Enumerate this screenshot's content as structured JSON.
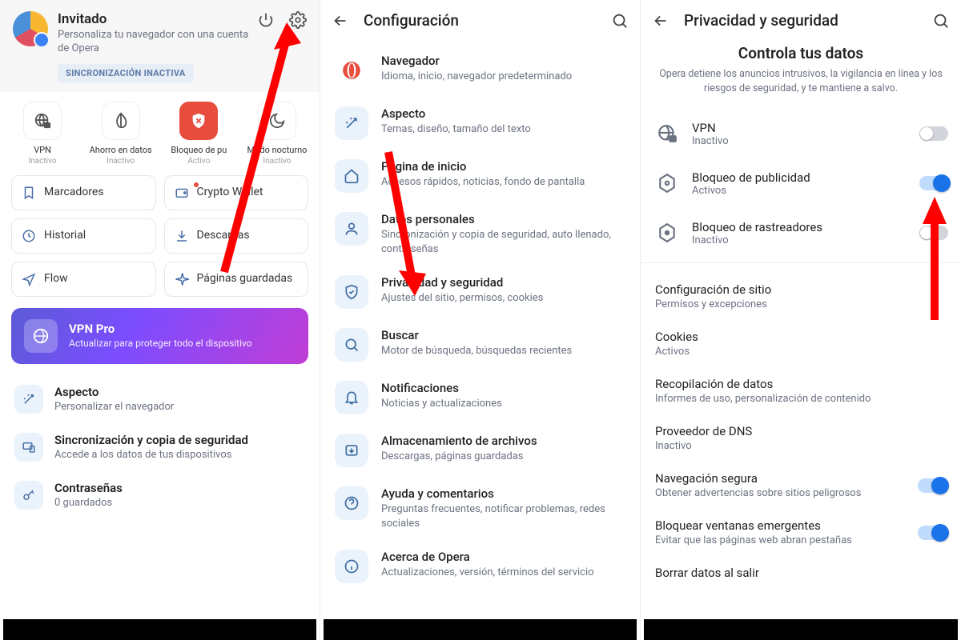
{
  "panel1": {
    "user_title": "Invitado",
    "user_sub": "Personaliza tu navegador con una cuenta de Opera",
    "sync_badge": "SINCRONIZACIÓN INACTIVA",
    "quick": [
      {
        "label": "VPN",
        "status": "Inactivo"
      },
      {
        "label": "Ahorro en datos",
        "status": "Inactivo"
      },
      {
        "label": "Bloqueo de pu",
        "status": "Activo"
      },
      {
        "label": "Modo nocturno",
        "status": "Inactivo"
      }
    ],
    "tiles": [
      {
        "label": "Marcadores"
      },
      {
        "label": "Crypto Wallet"
      },
      {
        "label": "Historial"
      },
      {
        "label": "Descargas"
      },
      {
        "label": "Flow"
      },
      {
        "label": "Páginas guardadas"
      }
    ],
    "vpnpro_title": "VPN Pro",
    "vpnpro_sub": "Actualizar para proteger todo el dispositivo",
    "opts": [
      {
        "title": "Aspecto",
        "sub": "Personalizar el navegador"
      },
      {
        "title": "Sincronización y copia de seguridad",
        "sub": "Accede a los datos de tus dispositivos"
      },
      {
        "title": "Contraseñas",
        "sub": "0 guardados"
      }
    ]
  },
  "panel2": {
    "title": "Configuración",
    "rows": [
      {
        "title": "Navegador",
        "sub": "Idioma, inicio, navegador predeterminado"
      },
      {
        "title": "Aspecto",
        "sub": "Temas, diseño, tamaño del texto"
      },
      {
        "title": "Página de inicio",
        "sub": "Accesos rápidos, noticias, fondo de pantalla"
      },
      {
        "title": "Datos personales",
        "sub": "Sincronización y copia de seguridad, auto llenado, contraseñas"
      },
      {
        "title": "Privacidad y seguridad",
        "sub": "Ajustes del sitio, permisos, cookies"
      },
      {
        "title": "Buscar",
        "sub": "Motor de búsqueda, búsquedas recientes"
      },
      {
        "title": "Notificaciones",
        "sub": "Noticias y actualizaciones"
      },
      {
        "title": "Almacenamiento de archivos",
        "sub": "Descargas, páginas guardadas"
      },
      {
        "title": "Ayuda y comentarios",
        "sub": "Preguntas frecuentes, notificar problemas, redes sociales"
      },
      {
        "title": "Acerca de Opera",
        "sub": "Actualizaciones, versión, términos del servicio"
      }
    ]
  },
  "panel3": {
    "title": "Privacidad y seguridad",
    "hero_title": "Controla tus datos",
    "hero_sub": "Opera detiene los anuncios intrusivos, la vigilancia en línea y los riesgos de seguridad, y te mantiene a salvo.",
    "top": [
      {
        "title": "VPN",
        "sub": "Inactivo",
        "on": false
      },
      {
        "title": "Bloqueo de publicidad",
        "sub": "Activos",
        "on": true
      },
      {
        "title": "Bloqueo de rastreadores",
        "sub": "Inactivo",
        "on": false
      }
    ],
    "list": [
      {
        "title": "Configuración de sitio",
        "sub": "Permisos y excepciones"
      },
      {
        "title": "Cookies",
        "sub": "Activos"
      },
      {
        "title": "Recopilación de datos",
        "sub": "Informes de uso, personalización de contenido"
      },
      {
        "title": "Proveedor de DNS",
        "sub": "Inactivo"
      },
      {
        "title": "Navegación segura",
        "sub": "Obtener advertencias sobre sitios peligrosos",
        "toggle": true
      },
      {
        "title": "Bloquear ventanas emergentes",
        "sub": "Evitar que las páginas web abran pestañas",
        "toggle": true
      },
      {
        "title": "Borrar datos al salir",
        "sub": ""
      }
    ]
  }
}
